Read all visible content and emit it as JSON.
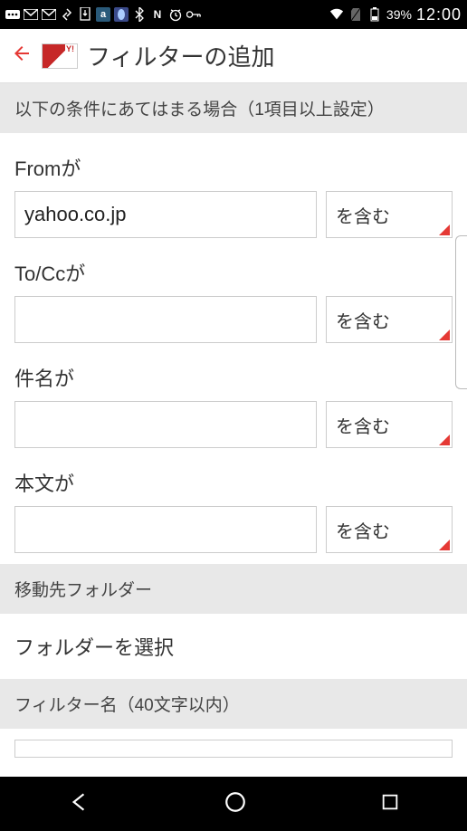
{
  "statusBar": {
    "batteryPercent": "39%",
    "clock": "12:00"
  },
  "header": {
    "title": "フィルターの追加"
  },
  "conditions": {
    "sectionTitle": "以下の条件にあてはまる場合（1項目以上設定）",
    "fields": {
      "from": {
        "label": "Fromが",
        "value": "yahoo.co.jp",
        "matchType": "を含む"
      },
      "tocc": {
        "label": "To/Ccが",
        "value": "",
        "matchType": "を含む"
      },
      "subject": {
        "label": "件名が",
        "value": "",
        "matchType": "を含む"
      },
      "body": {
        "label": "本文が",
        "value": "",
        "matchType": "を含む"
      }
    }
  },
  "moveFolder": {
    "sectionTitle": "移動先フォルダー",
    "selectLabel": "フォルダーを選択"
  },
  "filterName": {
    "sectionTitle": "フィルター名（40文字以内）"
  }
}
